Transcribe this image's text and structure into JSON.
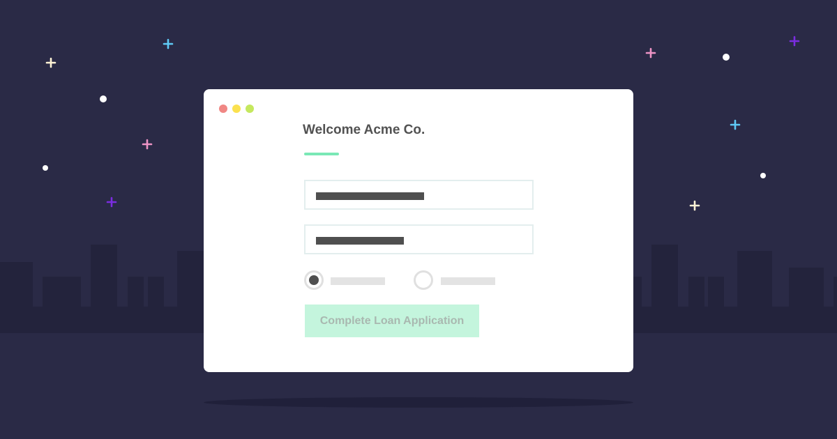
{
  "page": {
    "background_color": "#2a2a46",
    "skyline_color": "#23233c",
    "building_color": "#2d2d48"
  },
  "window": {
    "background_color": "#ffffff",
    "controls": [
      {
        "name": "close",
        "color": "#f08784"
      },
      {
        "name": "minimize",
        "color": "#fbe14f"
      },
      {
        "name": "maximize",
        "color": "#c5e85e"
      }
    ],
    "title": "Welcome Acme Co.",
    "accent_color": "#7ae8b6"
  },
  "form": {
    "fields": [
      {
        "name": "field-1",
        "masked": true
      },
      {
        "name": "field-2",
        "masked": true
      }
    ],
    "radios": [
      {
        "name": "option-1",
        "selected": true
      },
      {
        "name": "option-2",
        "selected": false
      }
    ],
    "submit_label": "Complete Loan Application",
    "submit_bg_color": "#c4f5dd",
    "submit_text_color": "#a9b8b0"
  },
  "decorations": {
    "plus_colors": [
      "#fff4d6",
      "#5fcaf6",
      "#ee94c6",
      "#7b2de0"
    ],
    "dot_color": "#ffffff"
  }
}
